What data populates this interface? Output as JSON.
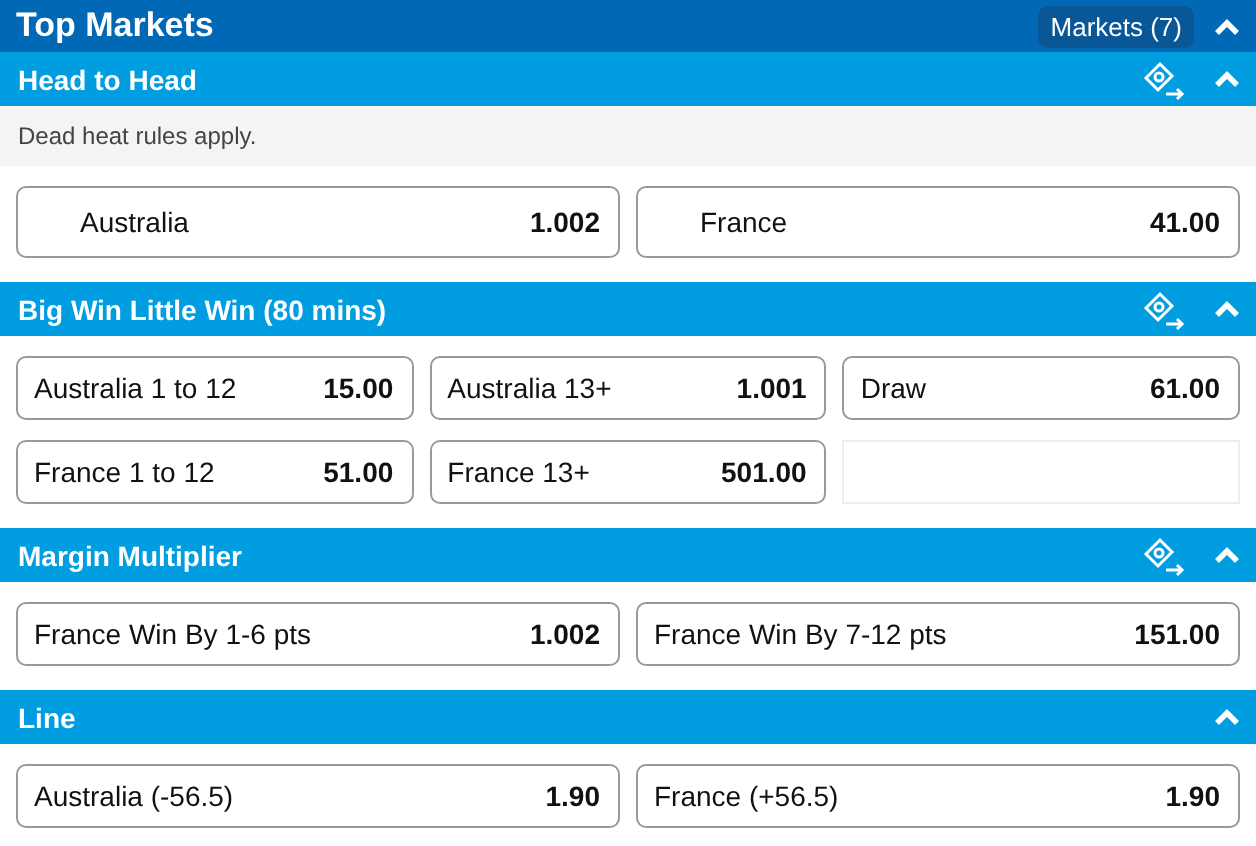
{
  "header": {
    "title": "Top Markets",
    "markets_button": "Markets (7)",
    "expanded": true
  },
  "sections": [
    {
      "title": "Head to Head",
      "kind": "indented",
      "cash_out": true,
      "expanded": true,
      "note": "Dead heat rules apply.",
      "outcomes": [
        {
          "name": "Australia",
          "odds": "1.002"
        },
        {
          "name": "France",
          "odds": "41.00"
        }
      ]
    },
    {
      "title": "Big Win Little Win (80 mins)",
      "kind": "standard",
      "cash_out": true,
      "expanded": true,
      "outcomes": [
        {
          "name": "Australia 1 to 12",
          "odds": "15.00"
        },
        {
          "name": "Australia 13+",
          "odds": "1.001"
        },
        {
          "name": "Draw",
          "odds": "61.00"
        },
        {
          "name": "France 1 to 12",
          "odds": "51.00"
        },
        {
          "name": "France 13+",
          "odds": "501.00"
        }
      ]
    },
    {
      "title": "Margin Multiplier",
      "kind": "standard",
      "cash_out": true,
      "expanded": true,
      "outcomes": [
        {
          "name": "France Win By 1-6 pts",
          "odds": "1.002"
        },
        {
          "name": "France Win By 7-12 pts",
          "odds": "151.00"
        }
      ]
    },
    {
      "title": "Line",
      "kind": "standard",
      "cash_out": false,
      "expanded": true,
      "outcomes": [
        {
          "name": "Australia (-56.5)",
          "odds": "1.90"
        },
        {
          "name": "France (+56.5)",
          "odds": "1.90"
        }
      ]
    }
  ]
}
